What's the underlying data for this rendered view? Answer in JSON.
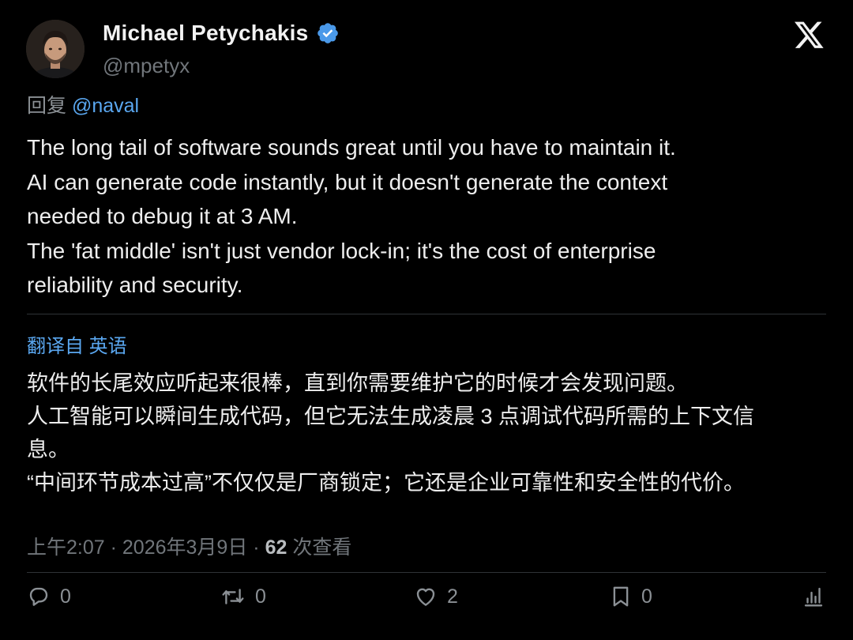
{
  "author": {
    "display_name": "Michael Petychakis",
    "handle": "@mpetyx",
    "verified": true
  },
  "brand": {
    "logo": "x-logo-icon"
  },
  "reply": {
    "prefix": "回复",
    "mention": "@naval"
  },
  "tweet": {
    "lines": [
      "The long tail of software sounds great until you have to maintain it.",
      "AI can generate code instantly, but it doesn't generate the context",
      "needed to debug it at 3 AM.",
      "The 'fat middle' isn't just vendor lock-in; it's the cost of enterprise",
      "reliability and security."
    ]
  },
  "translation": {
    "label": "翻译自 英语",
    "lines": [
      "软件的长尾效应听起来很棒，直到你需要维护它的时候才会发现问题。",
      "人工智能可以瞬间生成代码，但它无法生成凌晨 3 点调试代码所需的上下文信",
      "息。",
      "“中间环节成本过高”不仅仅是厂商锁定；它还是企业可靠性和安全性的代价。"
    ]
  },
  "meta": {
    "time": "上午2:07",
    "separator": "·",
    "date": "2026年3月9日",
    "views_count": "62",
    "views_label": "次查看"
  },
  "actions": {
    "replies": "0",
    "retweets": "0",
    "likes": "2",
    "bookmarks": "0"
  },
  "colors": {
    "background": "#000000",
    "text": "#e7e9ea",
    "secondary": "#71767b",
    "link": "#5aa7f0",
    "verified": "#4a99e9",
    "divider": "#2f3336"
  }
}
